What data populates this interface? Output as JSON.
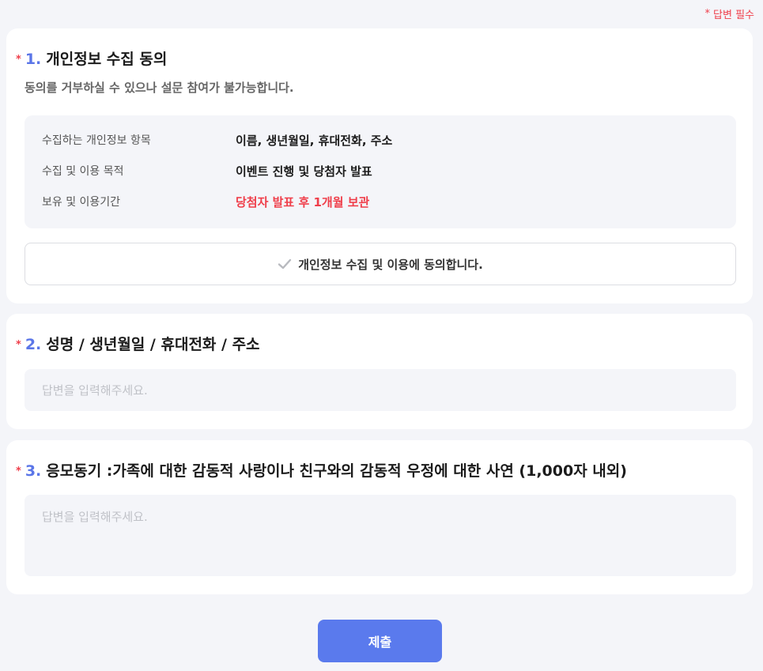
{
  "required_note": {
    "star": "*",
    "label": "답변 필수"
  },
  "q1": {
    "star": "*",
    "num": "1.",
    "title": "개인정보 수집 동의",
    "subtext": "동의를 거부하실 수 있으나 설문 참여가 불가능합니다.",
    "rows": [
      {
        "label": "수집하는 개인정보 항목",
        "value": "이름, 생년월일, 휴대전화, 주소"
      },
      {
        "label": "수집 및 이용 목적",
        "value": "이벤트 진행 및 당첨자 발표"
      },
      {
        "label": "보유 및 이용기간",
        "value": "당첨자 발표 후 1개월 보관"
      }
    ],
    "agree_label": "개인정보 수집 및 이용에 동의합니다.",
    "highlight_color": "#ef3e4a"
  },
  "q2": {
    "star": "*",
    "num": "2.",
    "title": "성명 / 생년월일 / 휴대전화 / 주소",
    "placeholder": "답변을 입력해주세요."
  },
  "q3": {
    "star": "*",
    "num": "3.",
    "title": "응모동기 :가족에 대한 감동적 사랑이나 친구와의 감동적 우정에 대한 사연 (1,000자 내외)",
    "placeholder": "답변을 입력해주세요."
  },
  "submit_label": "제출",
  "icons": {
    "agree": "check-icon"
  },
  "colors": {
    "accent": "#5a7aed",
    "required": "#ef3e4a",
    "background": "#f4f5f9"
  }
}
